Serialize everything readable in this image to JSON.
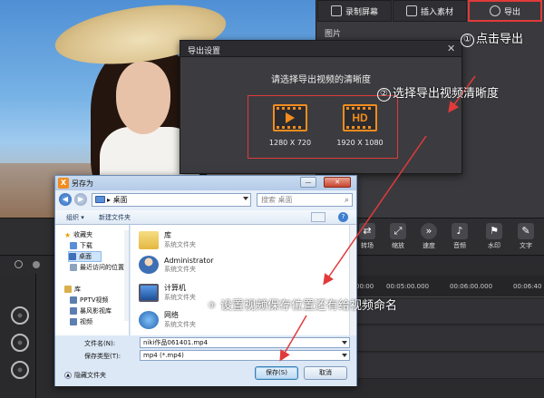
{
  "app": {
    "tabs": [
      {
        "label": "录制屏幕",
        "icon": "record-screen-icon"
      },
      {
        "label": "插入素材",
        "icon": "insert-material-icon"
      },
      {
        "label": "导出",
        "icon": "export-reel-icon",
        "active": true
      }
    ],
    "panel_label": "图片",
    "tools": [
      {
        "label": "转场",
        "icon": "transition-icon"
      },
      {
        "label": "缩放",
        "icon": "zoom-icon"
      },
      {
        "label": "速度",
        "icon": "speed-icon"
      },
      {
        "label": "音频",
        "icon": "audio-icon"
      },
      {
        "label": "水印",
        "icon": "watermark-icon"
      },
      {
        "label": "文字",
        "icon": "text-pen-icon"
      }
    ],
    "ruler_ticks": [
      "00:00",
      "00:05:00.000",
      "00:06:00.000",
      "00:06:40"
    ]
  },
  "export_dialog": {
    "title": "导出设置",
    "close": "✕",
    "prompt": "请选择导出视频的清晰度",
    "options": [
      {
        "label": "1280 X 720",
        "badge": ""
      },
      {
        "label": "1920 X 1080",
        "badge": "HD"
      }
    ]
  },
  "save_dialog": {
    "title": "另存为",
    "logo": "X",
    "address": "桌面",
    "address_arrow": "▸",
    "search_placeholder": "搜索 桌面",
    "commands": {
      "organize": "组织 ▾",
      "new_folder": "新建文件夹",
      "help": "?"
    },
    "nav": [
      {
        "label": "收藏夹",
        "icon": "star-icon"
      },
      {
        "label": "下载",
        "icon": "download-folder-icon"
      },
      {
        "label": "桌面",
        "icon": "desktop-icon",
        "selected": true
      },
      {
        "label": "最近访问的位置",
        "icon": "recent-places-icon"
      },
      {
        "label": "库",
        "icon": "library-icon"
      },
      {
        "label": "PPTV视频",
        "icon": "video-folder-icon"
      },
      {
        "label": "暴风影视库",
        "icon": "video-folder-icon"
      },
      {
        "label": "视频",
        "icon": "video-folder-icon"
      }
    ],
    "files": [
      {
        "name": "库",
        "type": "系统文件夹",
        "icon": "library-folder-icon"
      },
      {
        "name": "Administrator",
        "type": "系统文件夹",
        "icon": "user-folder-icon"
      },
      {
        "name": "计算机",
        "type": "系统文件夹",
        "icon": "computer-icon"
      },
      {
        "name": "网络",
        "type": "系统文件夹",
        "icon": "network-icon"
      }
    ],
    "filename_label": "文件名(N):",
    "filename_value": "niki作品061401.mp4",
    "filetype_label": "保存类型(T):",
    "filetype_value": "mp4 (*.mp4)",
    "hide_folders": "隐藏文件夹",
    "save_button": "保存(S)",
    "cancel_button": "取消"
  },
  "annotations": {
    "step1": {
      "num": "①",
      "text": "点击导出"
    },
    "step2": {
      "num": "②",
      "text": "选择导出视频清晰度"
    },
    "step3": {
      "num": "③",
      "text": "设置视频保存位置还有给视频命名"
    }
  },
  "colors": {
    "highlight_red": "#e13a3a",
    "accent_orange": "#f28c1e",
    "dark_bg": "#2b2b2e"
  }
}
